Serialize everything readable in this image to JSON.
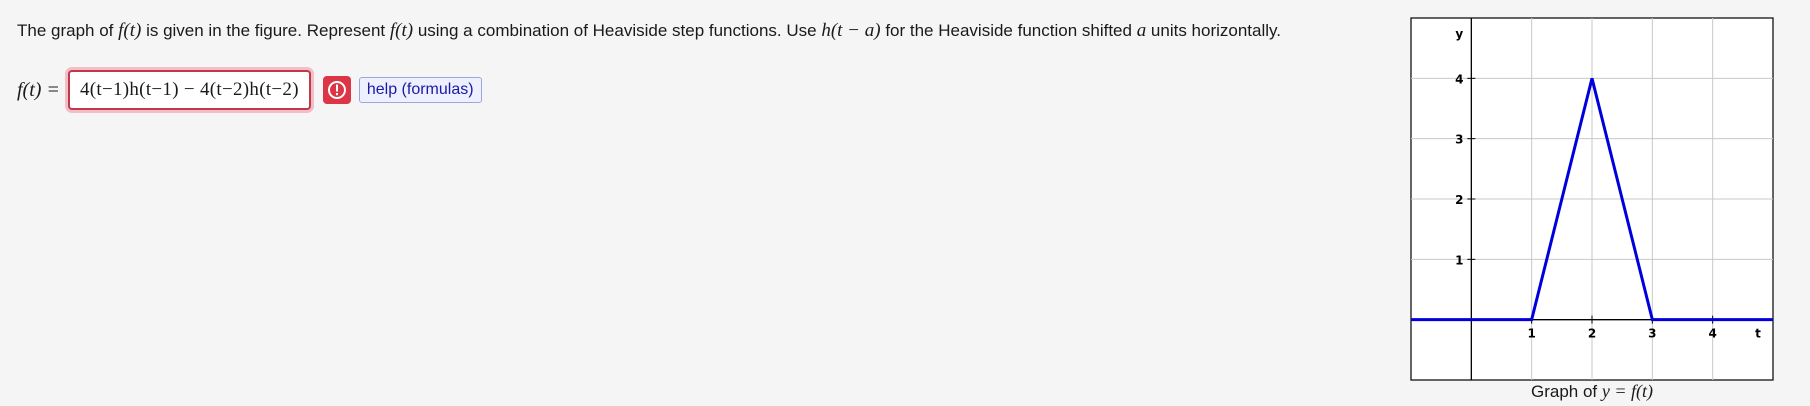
{
  "problem": {
    "t1": "The graph of ",
    "m1": "f(t)",
    "t2": " is given in the figure. Represent ",
    "m2": "f(t)",
    "t3": " using a combination of Heaviside step functions. Use ",
    "m3": "h(t − a)",
    "t4": " for the Heaviside function shifted ",
    "m4": "a",
    "t5": " units horizontally."
  },
  "answer": {
    "lhs": "f(t) =",
    "value": "4(t−1)h(t−1) − 4(t−2)h(t−2)",
    "status_icon": "exclamation-circle-icon"
  },
  "help": {
    "label": "help (formulas)"
  },
  "colors": {
    "error": "#dc3545",
    "line": "#0000dd",
    "link": "#1a1aa6"
  },
  "chart_data": {
    "type": "line",
    "title": "",
    "xlabel": "t",
    "ylabel": "y",
    "xlim": [
      -1,
      5
    ],
    "ylim": [
      -1,
      5
    ],
    "grid": true,
    "x_ticks": [
      "1",
      "2",
      "3",
      "4"
    ],
    "y_ticks": [
      "1",
      "2",
      "3",
      "4"
    ],
    "series": [
      {
        "x": [
          -1,
          1,
          2,
          3,
          5
        ],
        "y": [
          0,
          0,
          4,
          0,
          0
        ]
      }
    ],
    "caption_prefix": "Graph of ",
    "caption_math": "y = f(t)"
  }
}
